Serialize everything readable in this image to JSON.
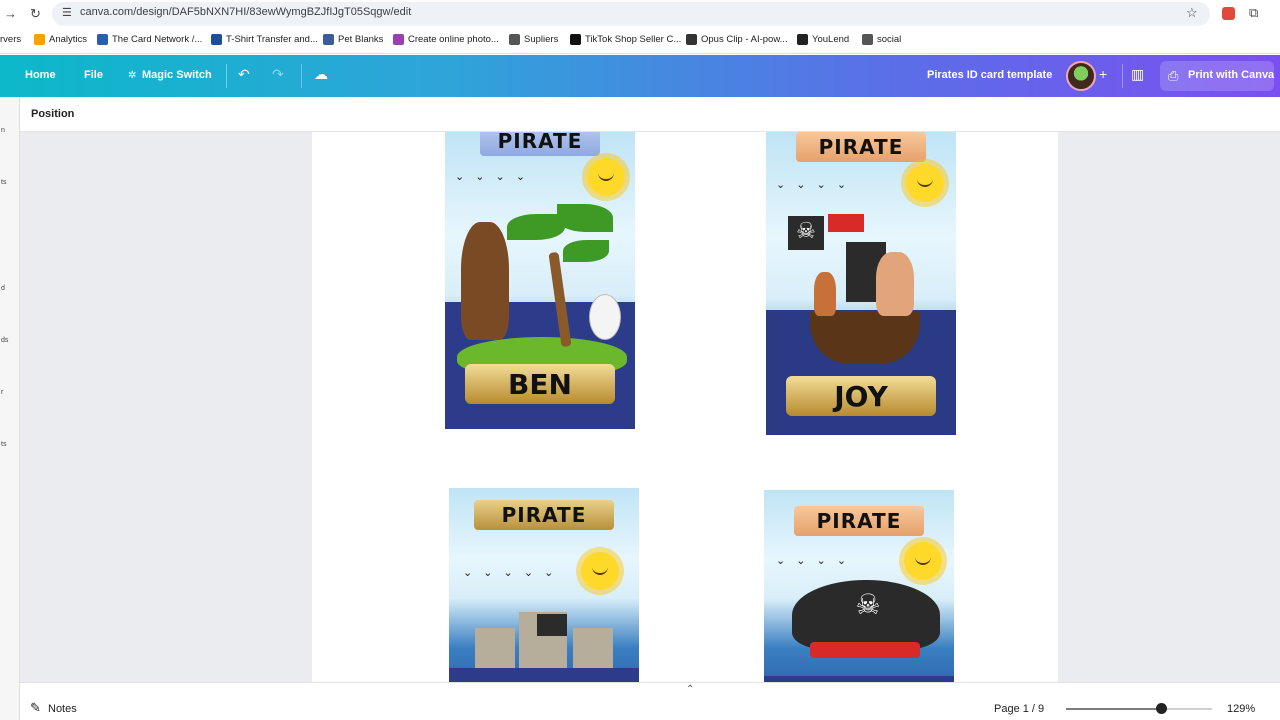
{
  "browser": {
    "url": "canva.com/design/DAF5bNXN7HI/83ewWymgBZJfIJgT05Sqgw/edit",
    "bookmarks": [
      {
        "label": "rvers",
        "color": "#ffffff"
      },
      {
        "label": "Analytics",
        "color": "#f4a300"
      },
      {
        "label": "The Card Network /...",
        "color": "#2a5db0"
      },
      {
        "label": "T-Shirt Transfer and...",
        "color": "#1d4e9e"
      },
      {
        "label": "Pet Blanks",
        "color": "#3b5b9b"
      },
      {
        "label": "Create online photo...",
        "color": "#9a3fb0"
      },
      {
        "label": "Supliers",
        "color": "#555555"
      },
      {
        "label": "TikTok Shop Seller C...",
        "color": "#111111"
      },
      {
        "label": "Opus Clip - AI-pow...",
        "color": "#333333"
      },
      {
        "label": "YouLend",
        "color": "#222222"
      },
      {
        "label": "social",
        "color": "#555555"
      }
    ]
  },
  "toolbar": {
    "home": "Home",
    "file": "File",
    "magic_switch": "Magic Switch",
    "design_title": "Pirates ID card template",
    "print_label": "Print with Canva"
  },
  "context_bar": {
    "position_label": "Position"
  },
  "left_rail": {
    "fragments": [
      "n",
      "ts",
      "d",
      "ds",
      "r",
      "ts"
    ]
  },
  "cards": [
    {
      "ribbon": "PIRATE",
      "name": "BEN",
      "scene": "island"
    },
    {
      "ribbon": "PIRATE",
      "name": "JOY",
      "scene": "ship-kids"
    },
    {
      "ribbon": "PIRATE",
      "name": "",
      "scene": "galleon"
    },
    {
      "ribbon": "PIRATE",
      "name": "",
      "scene": "hat"
    }
  ],
  "footer": {
    "notes_label": "Notes",
    "page_indicator": "Page 1 / 9",
    "zoom_label": "129%",
    "zoom_slider_fraction": 0.65
  },
  "colors": {
    "toolbar_gradient_start": "#0cb8c9",
    "toolbar_gradient_end": "#7b4ff0",
    "workspace_bg": "#ebecf0"
  }
}
